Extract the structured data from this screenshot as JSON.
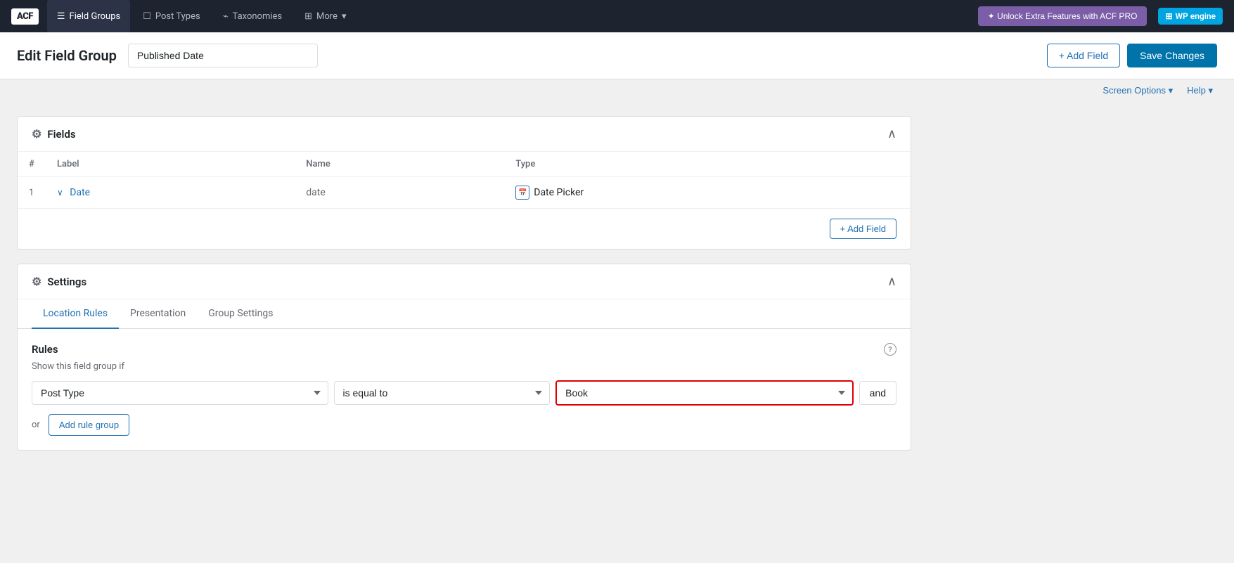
{
  "nav": {
    "logo": "ACF",
    "items": [
      {
        "label": "Field Groups",
        "active": true,
        "icon": "list-icon"
      },
      {
        "label": "Post Types",
        "active": false,
        "icon": "document-icon"
      },
      {
        "label": "Taxonomies",
        "active": false,
        "icon": "tag-icon"
      },
      {
        "label": "More",
        "active": false,
        "icon": "grid-icon",
        "has_dropdown": true
      }
    ],
    "unlock_btn": "✦ Unlock Extra Features with ACF PRO",
    "wpengine_label": "WP engine"
  },
  "page": {
    "title": "Edit Field Group",
    "field_group_name": "Published Date",
    "field_group_name_placeholder": "Published Date"
  },
  "header_actions": {
    "add_field_label": "+ Add Field",
    "save_changes_label": "Save Changes"
  },
  "screen_options": {
    "screen_options_label": "Screen Options ▾",
    "help_label": "Help ▾"
  },
  "fields_card": {
    "title": "Fields",
    "columns": {
      "hash": "#",
      "label": "Label",
      "name": "Name",
      "type": "Type"
    },
    "rows": [
      {
        "number": "1",
        "label": "Date",
        "name": "date",
        "type": "Date Picker"
      }
    ],
    "add_field_label": "+ Add Field"
  },
  "settings_card": {
    "title": "Settings",
    "tabs": [
      {
        "label": "Location Rules",
        "active": true
      },
      {
        "label": "Presentation",
        "active": false
      },
      {
        "label": "Group Settings",
        "active": false
      }
    ],
    "rules_label": "Rules",
    "show_if_label": "Show this field group if",
    "rule": {
      "condition_label": "Post Type",
      "operator_label": "is equal to",
      "value_label": "Book"
    },
    "and_label": "and",
    "or_label": "or",
    "add_rule_group_label": "Add rule group"
  }
}
